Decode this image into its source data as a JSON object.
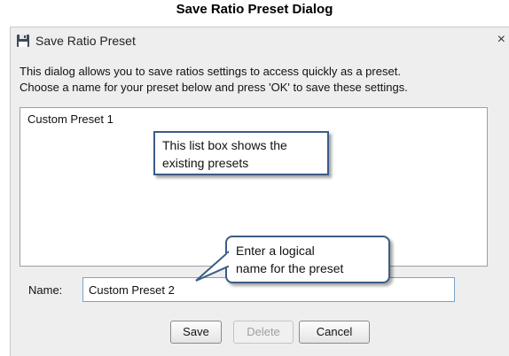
{
  "page": {
    "title": "Save Ratio Preset Dialog"
  },
  "dialog": {
    "title": "Save Ratio Preset",
    "close_label": "×",
    "instructions": [
      "This dialog allows you to save ratios settings to access quickly as a preset.",
      "Choose a name for your preset below and press 'OK' to save these settings."
    ],
    "list_items": [
      "Custom Preset 1"
    ],
    "name_label": "Name:",
    "name_value": "Custom Preset 2",
    "buttons": {
      "save": "Save",
      "delete": "Delete",
      "cancel": "Cancel"
    }
  },
  "callouts": {
    "listbox": [
      "This list box shows the",
      "existing presets"
    ],
    "name": [
      "Enter a logical",
      "name for the preset"
    ]
  },
  "icons": {
    "dialog_icon": "save-icon"
  },
  "colors": {
    "callout_border": "#3b5c86",
    "input_border": "#7aa3cc"
  }
}
